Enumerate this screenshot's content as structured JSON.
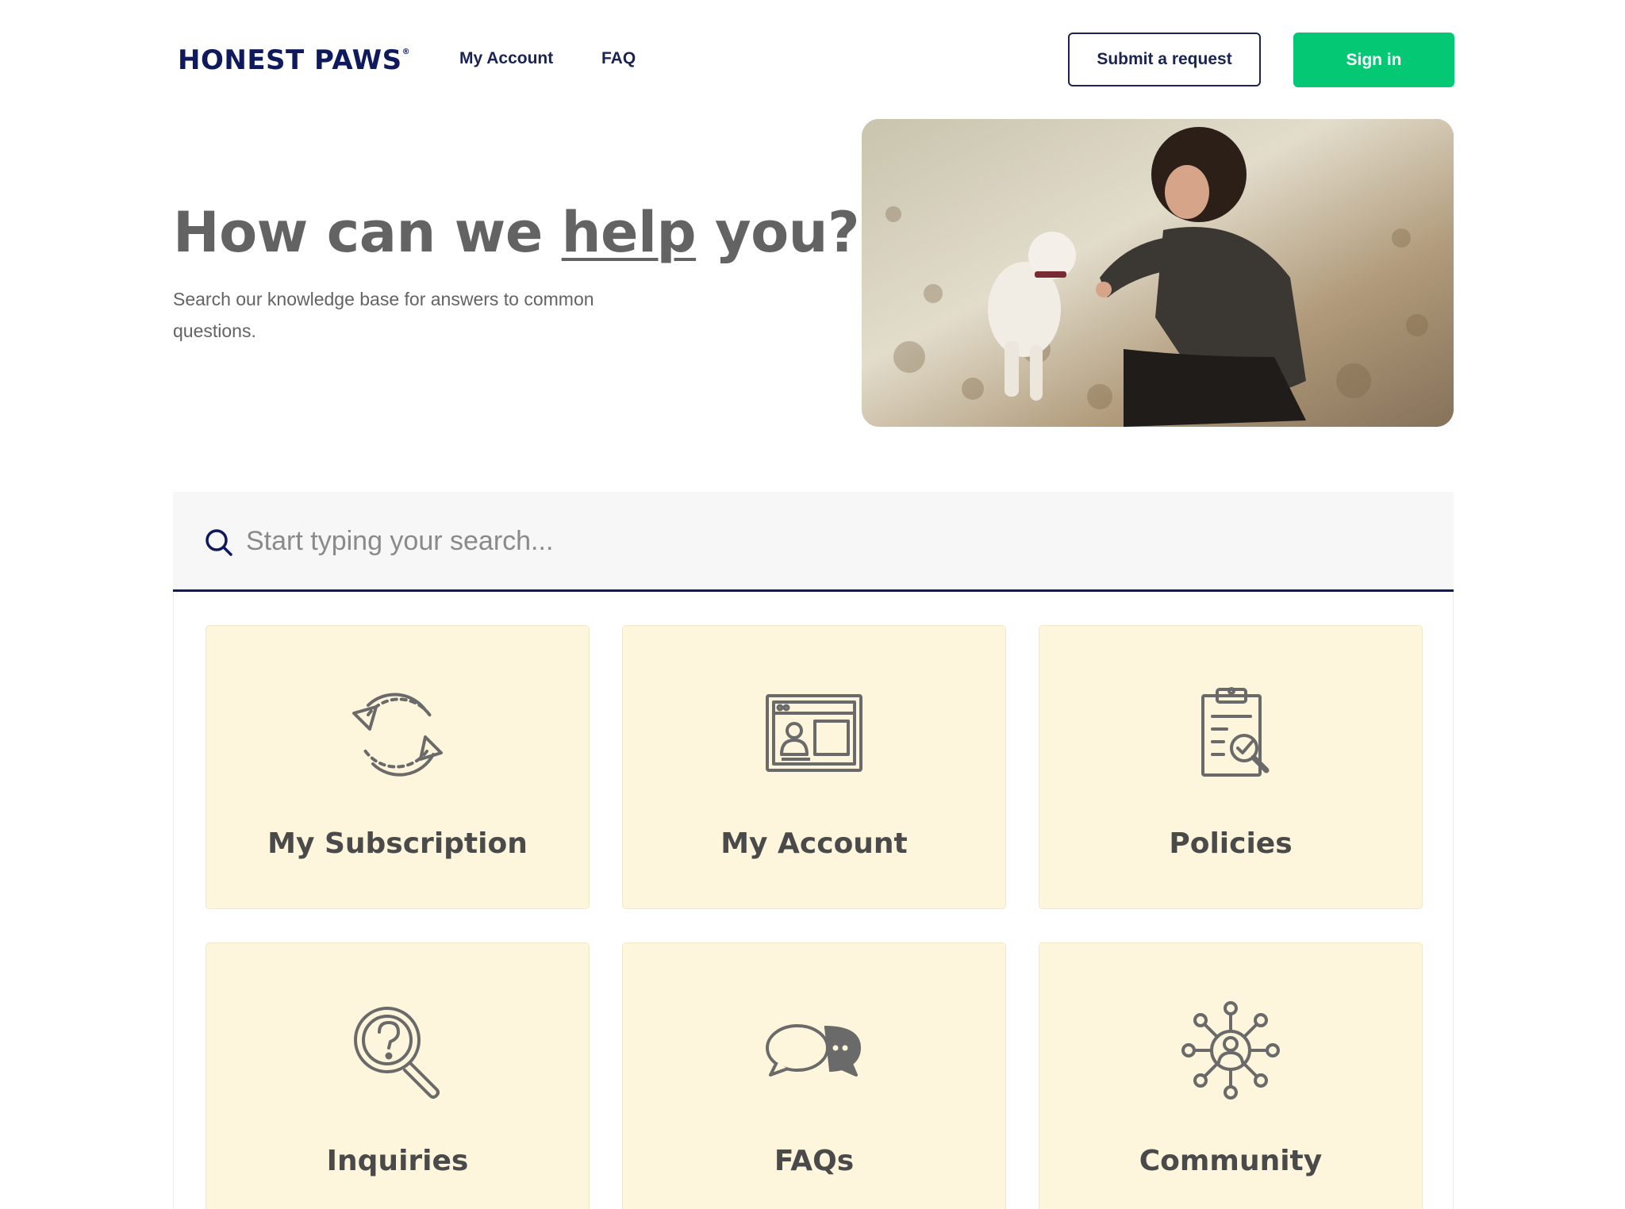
{
  "header": {
    "logo_text": "HONEST PAWS",
    "logo_mark": "®",
    "nav": [
      {
        "label": "My Account"
      },
      {
        "label": "FAQ"
      }
    ],
    "submit_label": "Submit a request",
    "signin_label": "Sign in"
  },
  "hero": {
    "title_pre": "How can we ",
    "title_emph": "help",
    "title_post": " you?",
    "subtitle": "Search our knowledge base for answers to common questions."
  },
  "search": {
    "placeholder": "Start typing your search..."
  },
  "categories": [
    {
      "label": "My Subscription",
      "icon": "refresh-icon"
    },
    {
      "label": "My Account",
      "icon": "profile-window-icon"
    },
    {
      "label": "Policies",
      "icon": "clipboard-check-icon"
    },
    {
      "label": "Inquiries",
      "icon": "question-magnifier-icon"
    },
    {
      "label": "FAQs",
      "icon": "chat-bubbles-icon"
    },
    {
      "label": "Community",
      "icon": "network-user-icon"
    }
  ],
  "colors": {
    "brand_navy": "#0f1a5c",
    "accent_green": "#05c875",
    "card_bg": "#fdf5dc",
    "icon_gray": "#6a6a6a"
  }
}
